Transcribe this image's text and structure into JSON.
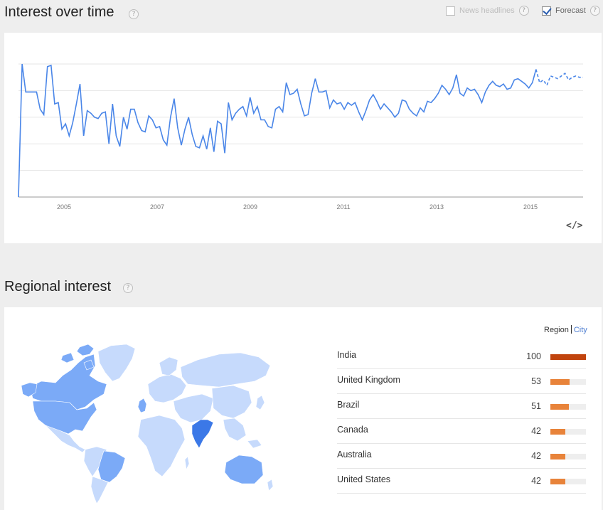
{
  "interest": {
    "title": "Interest over time",
    "news_headlines_label": "News headlines",
    "news_headlines_checked": false,
    "forecast_label": "Forecast",
    "forecast_checked": true,
    "embed_label": "</>",
    "line_color": "#4a86e8",
    "x_tick_labels": [
      "2005",
      "2007",
      "2009",
      "2011",
      "2013",
      "2015"
    ],
    "y_gridlines": 5,
    "series": [
      0,
      100,
      79,
      79,
      79,
      79,
      66,
      62,
      98,
      99,
      70,
      71,
      51,
      55,
      46,
      56,
      70,
      85,
      46,
      65,
      63,
      60,
      59,
      63,
      64,
      40,
      70,
      46,
      38,
      60,
      51,
      66,
      66,
      56,
      50,
      49,
      61,
      58,
      52,
      53,
      43,
      39,
      60,
      74,
      52,
      39,
      51,
      60,
      47,
      38,
      37,
      46,
      36,
      52,
      34,
      57,
      55,
      33,
      71,
      58,
      63,
      66,
      68,
      61,
      75,
      63,
      68,
      58,
      58,
      53,
      52,
      66,
      68,
      64,
      86,
      77,
      78,
      81,
      70,
      61,
      62,
      78,
      89,
      79,
      79,
      80,
      67,
      73,
      70,
      71,
      66,
      71,
      69,
      71,
      64,
      58,
      65,
      73,
      77,
      72,
      66,
      70,
      67,
      64,
      60,
      63,
      73,
      72,
      66,
      63,
      61,
      67,
      64,
      72,
      71,
      74,
      78,
      84,
      81,
      77,
      82,
      92,
      78,
      76,
      82,
      80,
      81,
      77,
      71,
      79,
      84,
      87,
      84,
      83,
      85,
      81,
      82,
      88,
      89,
      87,
      85,
      82,
      86,
      96
    ],
    "forecast_series": [
      86,
      88,
      84,
      91,
      90,
      89,
      91,
      93,
      88,
      90,
      91,
      90,
      90
    ]
  },
  "regional": {
    "title": "Regional interest",
    "toggle_region": "Region",
    "toggle_city": "City",
    "bar_color_top": "#c1440e",
    "bar_color": "#e8833a",
    "rows": [
      {
        "name": "India",
        "value": 100
      },
      {
        "name": "United Kingdom",
        "value": 53
      },
      {
        "name": "Brazil",
        "value": 51
      },
      {
        "name": "Canada",
        "value": 42
      },
      {
        "name": "Australia",
        "value": 42
      },
      {
        "name": "United States",
        "value": 42
      }
    ],
    "map_colors": {
      "light": "#c6dafc",
      "medium": "#7baaf7",
      "dark": "#3b78e7"
    }
  }
}
